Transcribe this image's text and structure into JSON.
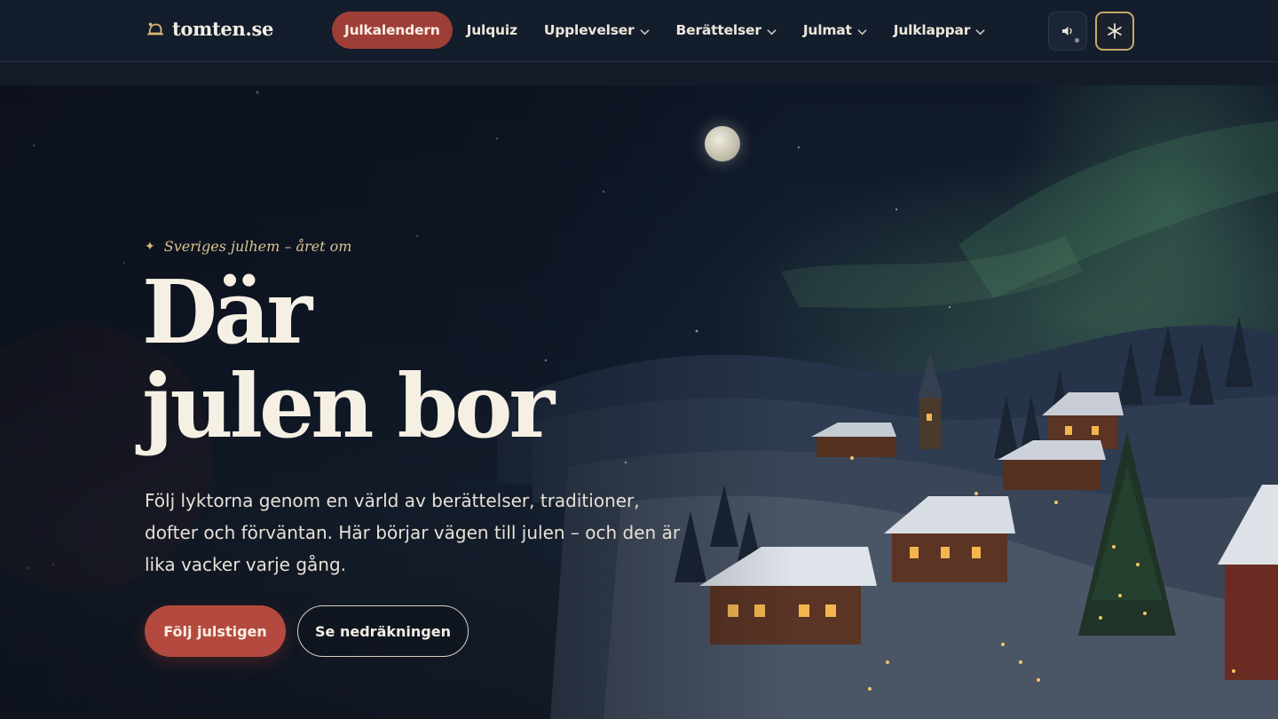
{
  "brand": {
    "name": "tomten.se"
  },
  "nav": {
    "items": [
      {
        "label": "Julkalendern",
        "active": true,
        "has_dropdown": false
      },
      {
        "label": "Julquiz",
        "active": false,
        "has_dropdown": false
      },
      {
        "label": "Upplevelser",
        "active": false,
        "has_dropdown": true
      },
      {
        "label": "Berättelser",
        "active": false,
        "has_dropdown": true
      },
      {
        "label": "Julmat",
        "active": false,
        "has_dropdown": true
      },
      {
        "label": "Julklappar",
        "active": false,
        "has_dropdown": true
      }
    ],
    "sound_icon": "speaker-icon",
    "snow_icon": "asterisk-snow-icon"
  },
  "hero": {
    "eyebrow": "Sveriges julhem – året om",
    "headline_line1": "Där",
    "headline_line2": "julen bor",
    "lead": "Följ lyktorna genom en värld av berättelser, traditioner, dofter och förväntan. Här börjar vägen till julen – och den är lika vacker varje gång.",
    "primary_cta": "Följ julstigen",
    "secondary_cta": "Se nedräkningen"
  },
  "colors": {
    "accent": "#9e3f37",
    "gold": "#c9a86a",
    "background": "#141d2c"
  }
}
